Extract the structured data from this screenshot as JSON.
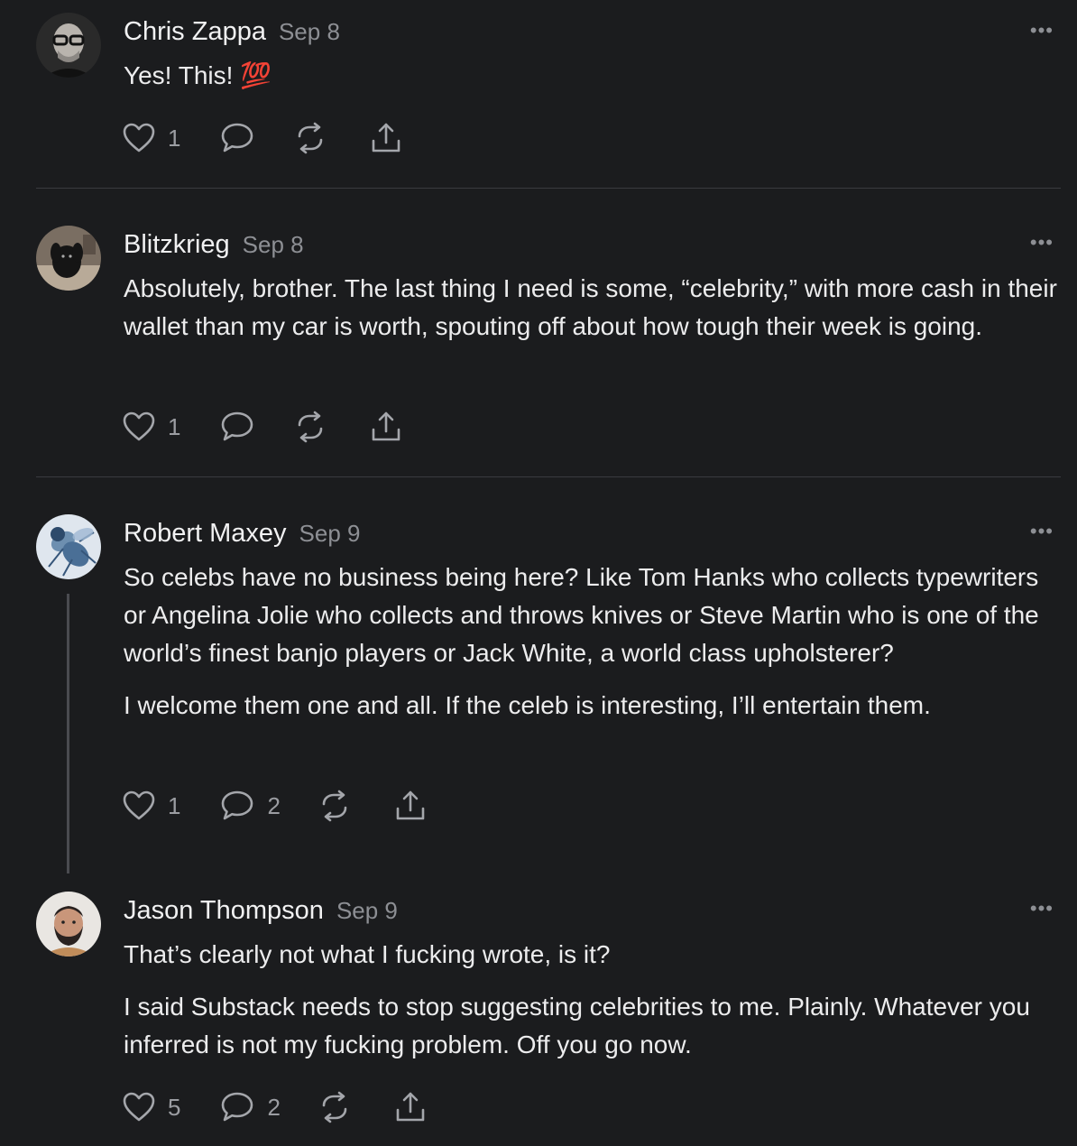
{
  "comments": [
    {
      "author": "Chris Zappa",
      "date": "Sep 8",
      "paragraphs": [
        "Yes! This! 💯"
      ],
      "likes": "1",
      "replies": "",
      "more_label": "•••"
    },
    {
      "author": "Blitzkrieg",
      "date": "Sep 8",
      "paragraphs": [
        "Absolutely, brother. The last thing I need is some, “celebrity,” with more cash in their wallet than my car is worth, spouting off about how tough their week is going."
      ],
      "likes": "1",
      "replies": "",
      "more_label": "•••"
    },
    {
      "author": "Robert Maxey",
      "date": "Sep 9",
      "paragraphs": [
        "So celebs have no business being here? Like Tom Hanks who collects typewriters or Angelina Jolie who collects and throws knives or Steve Martin who is one of the world’s finest banjo players or Jack White, a world class upholsterer?",
        "I welcome them one and all. If the celeb is interesting, I’ll entertain them."
      ],
      "likes": "1",
      "replies": "2",
      "more_label": "•••"
    },
    {
      "author": "Jason Thompson",
      "date": "Sep 9",
      "paragraphs": [
        "That’s clearly not what I fucking wrote, is it?",
        "I said Substack needs to stop suggesting celebrities to me. Plainly. Whatever you inferred is not my fucking problem. Off you go now."
      ],
      "likes": "5",
      "replies": "2",
      "more_label": "•••"
    }
  ],
  "icons": {
    "like": "heart-icon",
    "reply": "comment-bubble-icon",
    "restack": "restack-icon",
    "share": "share-icon",
    "more": "more-options-icon"
  },
  "colors": {
    "background": "#1b1c1e",
    "text": "#ececed",
    "muted": "#8d8f94",
    "divider": "#3a3b3f"
  }
}
